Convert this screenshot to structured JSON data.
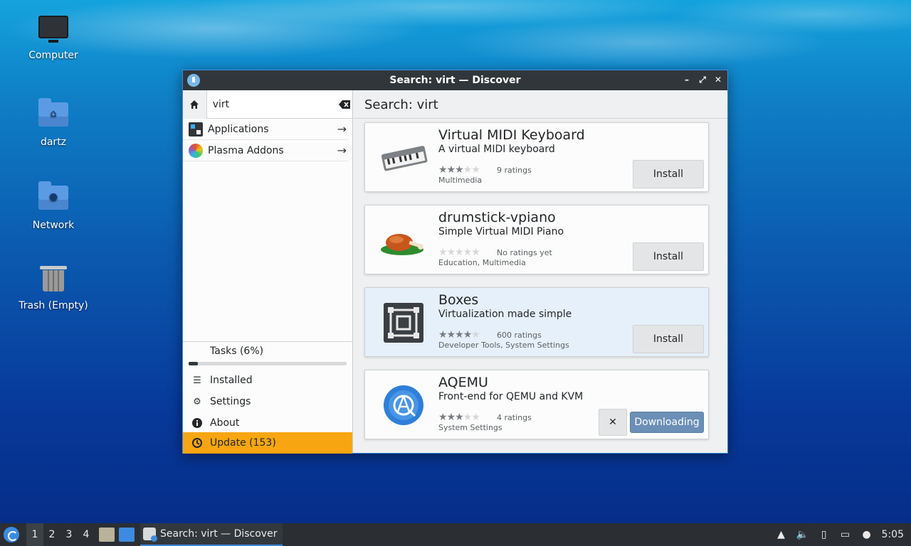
{
  "desktop": {
    "icons": [
      {
        "label": "Computer"
      },
      {
        "label": "dartz"
      },
      {
        "label": "Network"
      },
      {
        "label": "Trash (Empty)"
      }
    ]
  },
  "window": {
    "title": "Search: virt — Discover",
    "controls": {
      "minimize": "–",
      "maximize": "⤢",
      "close": "✕"
    }
  },
  "sidebar": {
    "search_value": "virt",
    "categories": [
      {
        "label": "Applications",
        "icon": "applications-icon"
      },
      {
        "label": "Plasma Addons",
        "icon": "plasma-addons-icon"
      }
    ],
    "tasks": {
      "label": "Tasks (6%)",
      "progress_fraction": 0.06
    },
    "nav": {
      "installed": "Installed",
      "settings": "Settings",
      "about": "About",
      "update": "Update (153)"
    }
  },
  "main": {
    "header": "Search: virt",
    "results": [
      {
        "name": "Virtual MIDI Keyboard",
        "description": "A virtual MIDI keyboard",
        "stars": 3,
        "ratings": "9 ratings",
        "categories": "Multimedia",
        "action": "Install"
      },
      {
        "name": "drumstick-vpiano",
        "description": "Simple Virtual MIDI Piano",
        "stars": 0,
        "ratings": "No ratings yet",
        "categories": "Education, Multimedia",
        "action": "Install"
      },
      {
        "name": "Boxes",
        "description": "Virtualization made simple",
        "stars": 4,
        "ratings": "600 ratings",
        "categories": "Developer Tools, System Settings",
        "action": "Install"
      },
      {
        "name": "AQEMU",
        "description": "Front-end for QEMU and KVM",
        "stars": 3,
        "ratings": "4 ratings",
        "categories": "System Settings",
        "action": "Downloading",
        "cancel": "✕"
      }
    ]
  },
  "taskbar": {
    "desktops": [
      "1",
      "2",
      "3",
      "4"
    ],
    "task_label": "Search: virt — Discover",
    "clock": "5:05"
  },
  "colors": {
    "accent": "#3d8be0",
    "update_highlight": "#f7a611",
    "titlebar": "#31363b"
  }
}
